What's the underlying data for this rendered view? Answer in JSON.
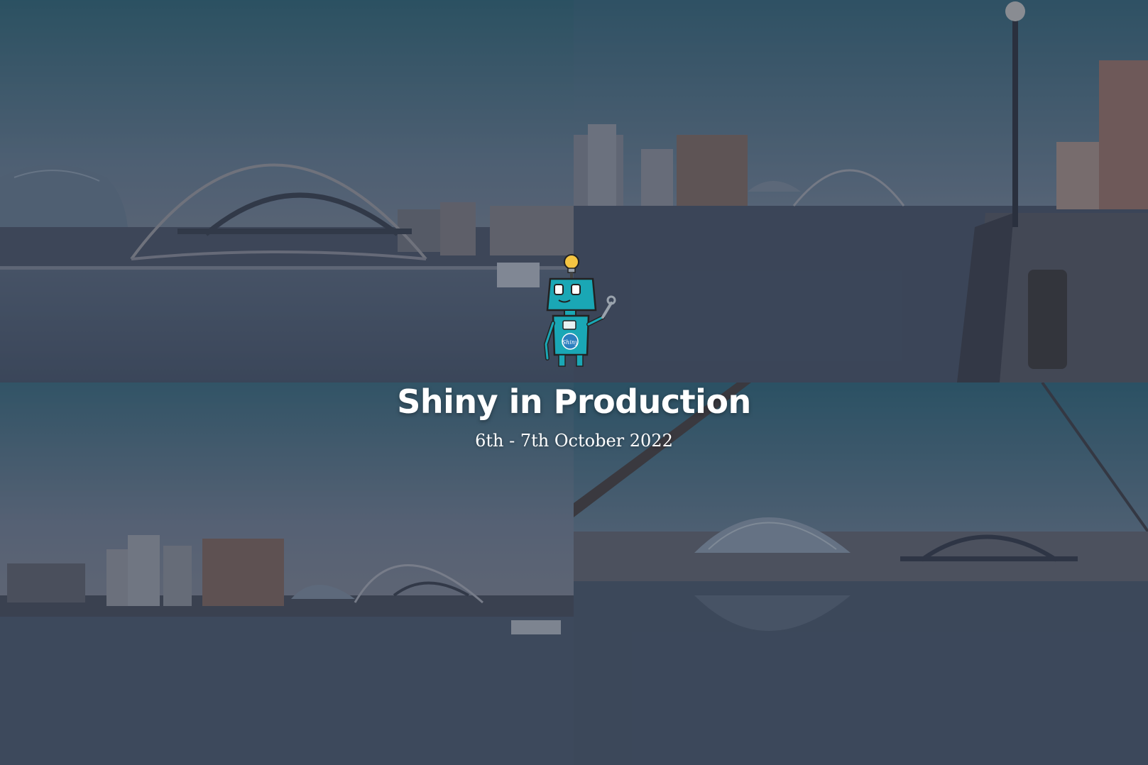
{
  "event": {
    "title": "Shiny in Production",
    "dates": "6th - 7th October 2022"
  },
  "mascot": {
    "icon": "shiny-robot-mascot-icon",
    "badge_text": "Shiny"
  },
  "photos": [
    {
      "name": "photo-tyne-bridges-sage",
      "position": "top-left"
    },
    {
      "name": "photo-quayside-promenade",
      "position": "top-right"
    },
    {
      "name": "photo-baltic-millennium-bridge",
      "position": "bottom-left"
    },
    {
      "name": "photo-sage-tyne-bridge-reflection",
      "position": "bottom-right"
    }
  ],
  "colors": {
    "overlay": "#283448",
    "sky": "#2f6675",
    "water": "#3b4a5c",
    "robot": "#1aa7b5",
    "bulb": "#f5c542",
    "title": "#ffffff"
  }
}
